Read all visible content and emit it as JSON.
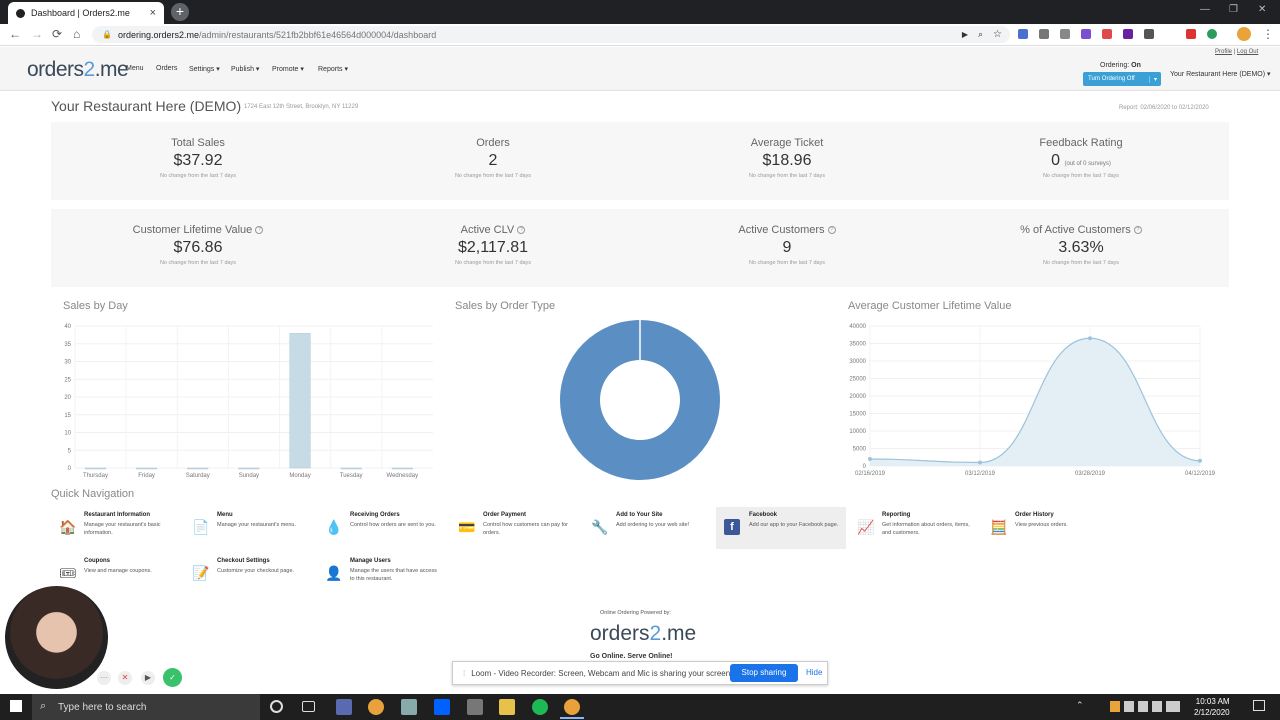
{
  "browser": {
    "tab_title": "Dashboard | Orders2.me",
    "url_host": "ordering.orders2.me",
    "url_path": "/admin/restaurants/521fb2bbf61e46564d000004/dashboard"
  },
  "header": {
    "logo_main": "orders",
    "logo_two": "2",
    "logo_suffix": ".me",
    "nav": [
      "Menu",
      "Orders",
      "Settings ▾",
      "Publish ▾",
      "Promote ▾",
      "Reports ▾"
    ],
    "ordering_label": "Ordering: ",
    "ordering_state": "On",
    "turn_off": "Turn Ordering Off",
    "restaurant_select": "Your Restaurant Here (DEMO) ▾",
    "profile": "Profile",
    "logout": "Log Out"
  },
  "page": {
    "title": "Your Restaurant Here (DEMO)",
    "address": "1724 East 12th Street, Brooklyn, NY 11229",
    "report": "Report: 02/06/2020 to 02/12/2020"
  },
  "stats_row1": [
    {
      "label": "Total Sales",
      "value": "$37.92",
      "note": "No change from the last 7 days"
    },
    {
      "label": "Orders",
      "value": "2",
      "note": "No change from the last 7 days"
    },
    {
      "label": "Average Ticket",
      "value": "$18.96",
      "note": "No change from the last 7 days"
    },
    {
      "label": "Feedback Rating",
      "value": "0",
      "sub": "(out of 0 surveys)",
      "note": "No change from the last 7 days"
    }
  ],
  "stats_row2": [
    {
      "label": "Customer Lifetime Value",
      "value": "$76.86",
      "note": "No change from the last 7 days"
    },
    {
      "label": "Active CLV",
      "value": "$2,117.81",
      "note": "No change from the last 7 days"
    },
    {
      "label": "Active Customers",
      "value": "9",
      "note": "No change from the last 7 days"
    },
    {
      "label": "% of Active Customers",
      "value": "3.63%",
      "note": "No change from the last 7 days"
    }
  ],
  "chart_data": [
    {
      "type": "bar",
      "title": "Sales by Day",
      "categories": [
        "Thursday",
        "Friday",
        "Saturday",
        "Sunday",
        "Monday",
        "Tuesday",
        "Wednesday"
      ],
      "values": [
        0,
        0,
        0,
        0,
        37.92,
        0,
        0
      ],
      "ylim": [
        0,
        40
      ],
      "yticks": [
        0,
        5,
        10,
        15,
        20,
        25,
        30,
        35,
        40
      ],
      "color": "#c6dbe6"
    },
    {
      "type": "pie",
      "title": "Sales by Order Type",
      "slices": [
        {
          "value": 100,
          "color": "#5b8fc3"
        }
      ],
      "donut": true
    },
    {
      "type": "area",
      "title": "Average Customer Lifetime Value",
      "x": [
        "02/16/2019",
        "03/12/2019",
        "03/28/2019",
        "04/12/2019"
      ],
      "values": [
        2000,
        1000,
        36500,
        1500
      ],
      "ylim": [
        0,
        40000
      ],
      "yticks": [
        0,
        5000,
        10000,
        15000,
        20000,
        25000,
        30000,
        35000,
        40000
      ],
      "color": "#9cc3dc"
    }
  ],
  "quick_nav_title": "Quick Navigation",
  "quick_nav": [
    {
      "title": "Restaurant Information",
      "desc": "Manage your restaurant's basic information.",
      "icon": "house-icon",
      "glyph": "🏠"
    },
    {
      "title": "Menu",
      "desc": "Manage your restaurant's menu.",
      "icon": "menu-icon",
      "glyph": "📄"
    },
    {
      "title": "Receiving Orders",
      "desc": "Control how orders are sent to you.",
      "icon": "orders-icon",
      "glyph": "💧"
    },
    {
      "title": "Order Payment",
      "desc": "Control how customers can pay for orders.",
      "icon": "payment-icon",
      "glyph": "💳"
    },
    {
      "title": "Add to Your Site",
      "desc": "Add ordering to your web site!",
      "icon": "wrench-icon",
      "glyph": "🔧"
    },
    {
      "title": "Facebook",
      "desc": "Add our app to your Facebook page.",
      "icon": "facebook-icon",
      "glyph": "f"
    },
    {
      "title": "Reporting",
      "desc": "Get information about orders, items, and customers.",
      "icon": "chart-icon",
      "glyph": "📈"
    },
    {
      "title": "Order History",
      "desc": "View previous orders.",
      "icon": "calculator-icon",
      "glyph": "🧮"
    },
    {
      "title": "Coupons",
      "desc": "View and manage coupons.",
      "icon": "coupon-icon",
      "glyph": "🎟"
    },
    {
      "title": "Checkout Settings",
      "desc": "Customize your checkout page.",
      "icon": "checkout-icon",
      "glyph": "📝"
    },
    {
      "title": "Manage Users",
      "desc": "Manage the users that have access to this restaurant.",
      "icon": "user-icon",
      "glyph": "👤"
    }
  ],
  "footer": {
    "powered": "Online Ordering Powered by:",
    "slogan": "Go Online. Serve Online!"
  },
  "loom": {
    "message": "Loom - Video Recorder: Screen, Webcam and Mic is sharing your screen.",
    "stop": "Stop sharing",
    "hide": "Hide"
  },
  "taskbar": {
    "search_placeholder": "Type here to search",
    "time": "10:03 AM",
    "date": "2/12/2020"
  }
}
